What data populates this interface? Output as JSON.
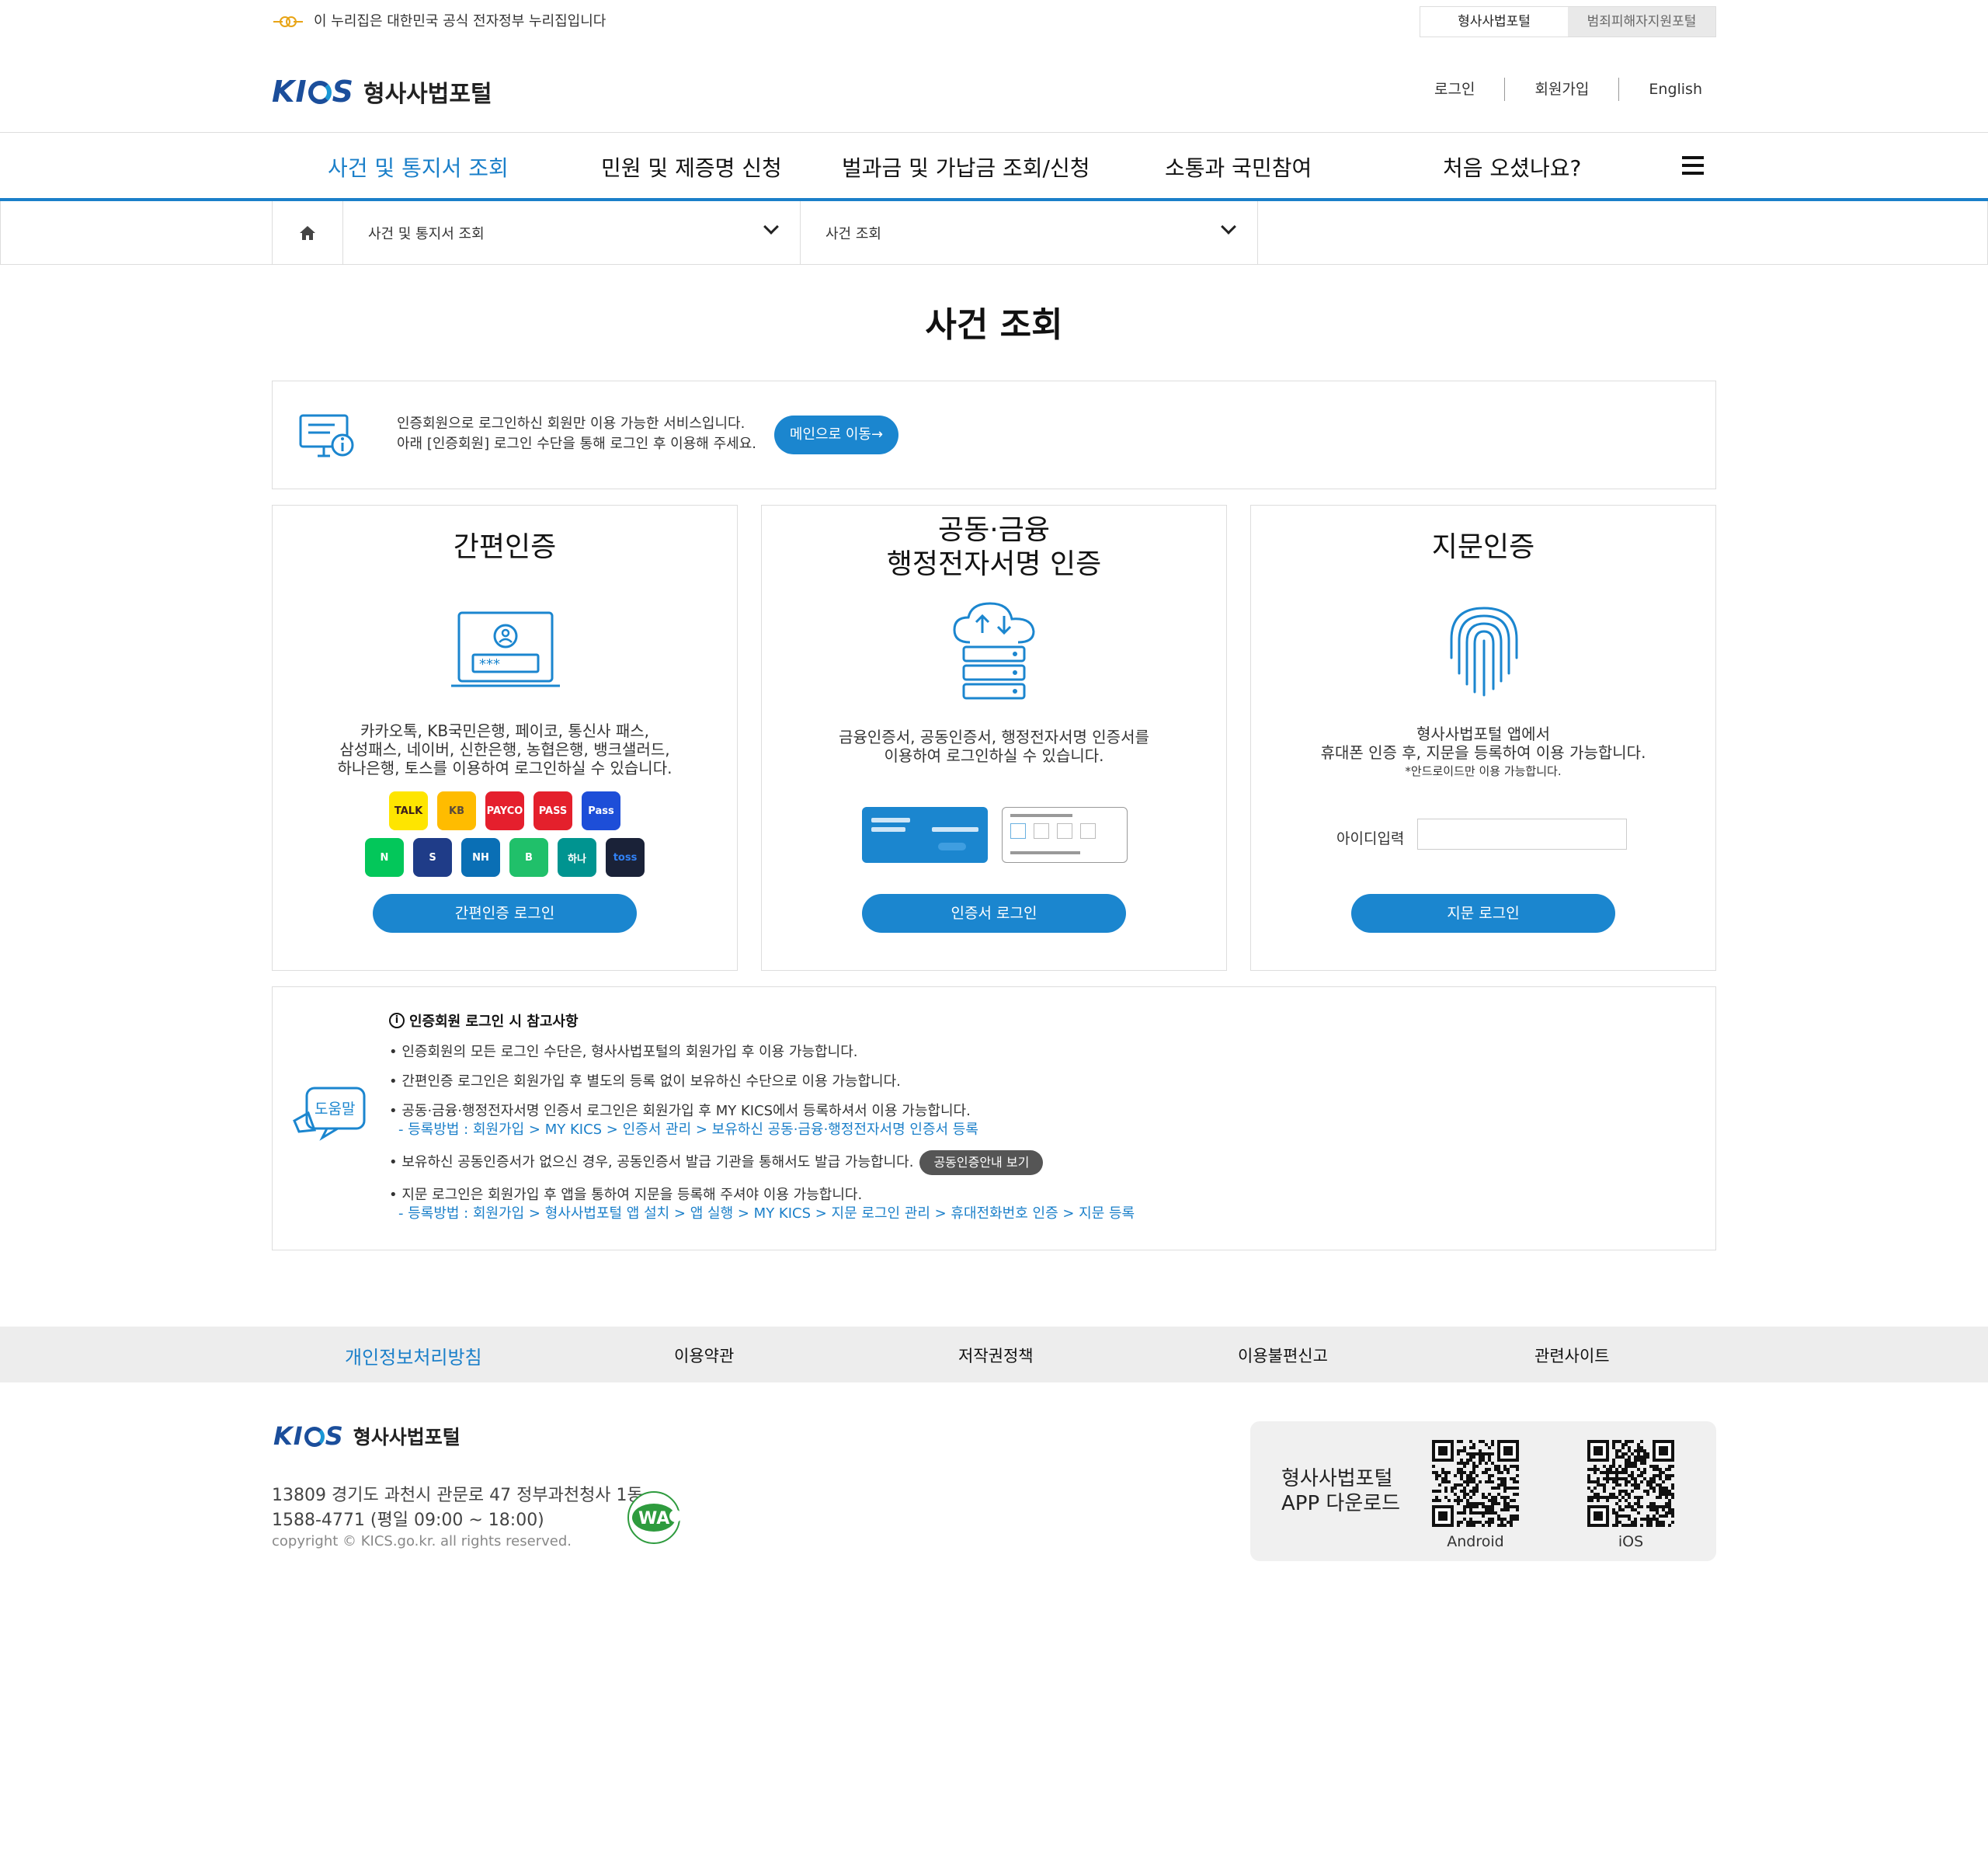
{
  "gov_banner": {
    "text": "이 누리집은 대한민국 공식 전자정부 누리집입니다",
    "tabs": [
      "형사사법포털",
      "범죄피해자지원포털"
    ]
  },
  "header": {
    "logo_mark": "KICS",
    "logo_text": "형사사법포털",
    "util": [
      "로그인",
      "회원가입",
      "English"
    ]
  },
  "gnb": [
    "사건 및 통지서 조회",
    "민원 및 제증명 신청",
    "벌과금 및 가납금 조회/신청",
    "소통과 국민참여",
    "처음 오셨나요?"
  ],
  "breadcrumb": {
    "level1": "사건 및 통지서 조회",
    "level2": "사건 조회"
  },
  "page_title": "사건 조회",
  "notice": {
    "line1": "인증회원으로 로그인하신 회원만 이용 가능한 서비스입니다.",
    "line2": "아래 [인증회원] 로그인 수단을 통해 로그인 후 이용해 주세요.",
    "button": "메인으로 이동→"
  },
  "cards": {
    "simple": {
      "title": "간편인증",
      "desc": [
        "카카오톡, KB국민은행, 페이코, 통신사 패스,",
        "삼성패스, 네이버, 신한은행, 농협은행, 뱅크샐러드,",
        "하나은행, 토스를 이용하여 로그인하실 수 있습니다."
      ],
      "apps_row1": [
        {
          "label": "TALK",
          "color": "#fee500",
          "fg": "#3a1d1d"
        },
        {
          "label": "KB",
          "color": "#ffbc00",
          "fg": "#5a4a3a"
        },
        {
          "label": "PAYCO",
          "color": "#e51f2d",
          "fg": "#ffffff"
        },
        {
          "label": "PASS",
          "color": "#e4202c",
          "fg": "#ffffff"
        },
        {
          "label": "Pass",
          "color": "#1d4ed8",
          "fg": "#ffffff"
        }
      ],
      "apps_row2": [
        {
          "label": "N",
          "color": "#03c75a",
          "fg": "#ffffff"
        },
        {
          "label": "S",
          "color": "#1f3c88",
          "fg": "#ffffff"
        },
        {
          "label": "NH",
          "color": "#0a6fb5",
          "fg": "#ffffff"
        },
        {
          "label": "B",
          "color": "#20c06a",
          "fg": "#ffffff"
        },
        {
          "label": "하나",
          "color": "#009490",
          "fg": "#ffffff"
        },
        {
          "label": "toss",
          "color": "#1a2238",
          "fg": "#3182f6"
        }
      ],
      "button": "간편인증 로그인"
    },
    "cert": {
      "title_line1": "공동·금융",
      "title_line2": "행정전자서명 인증",
      "desc": [
        "금융인증서, 공동인증서,  행정전자서명 인증서를",
        "이용하여 로그인하실 수 있습니다."
      ],
      "button": "인증서 로그인"
    },
    "finger": {
      "title": "지문인증",
      "desc": [
        "형사사법포털 앱에서",
        "휴대폰 인증 후, 지문을 등록하여 이용 가능합니다."
      ],
      "note": "*안드로이드만 이용 가능합니다.",
      "id_label": "아이디입력",
      "id_value": "",
      "button": "지문 로그인"
    }
  },
  "help": {
    "icon_label": "도움말",
    "heading": "인증회원 로그인 시 참고사항",
    "items": [
      {
        "text": "• 인증회원의 모든 로그인 수단은, 형사사법포털의 회원가입 후 이용 가능합니다."
      },
      {
        "text": "• 간편인증 로그인은 회원가입 후 별도의 등록 없이 보유하신 수단으로 이용 가능합니다."
      },
      {
        "text": "• 공동·금융·행정전자서명 인증서 로그인은 회원가입 후 MY KICS에서 등록하셔서 이용 가능합니다.",
        "sub": "- 등록방법 : 회원가입 > MY KICS > 인증서 관리 > 보유하신 공동·금융·행정전자서명 인증서 등록"
      },
      {
        "text": "• 보유하신 공동인증서가 없으신 경우, 공동인증서 발급 기관을 통해서도 발급 가능합니다.",
        "button": "공동인증안내 보기"
      },
      {
        "text": "• 지문 로그인은 회원가입 후 앱을 통하여 지문을 등록해 주셔야 이용 가능합니다.",
        "sub": "- 등록방법 : 회원가입 > 형사사법포털 앱 설치 > 앱 실행 > MY KICS > 지문 로그인 관리 > 휴대전화번호 인증 > 지문 등록"
      }
    ]
  },
  "footer": {
    "links": [
      "개인정보처리방침",
      "이용약관",
      "저작권정책",
      "이용불편신고",
      "관련사이트"
    ],
    "logo_text": "형사사법포털",
    "address": "13809  경기도 과천시 관문로 47 정부과천청사 1동",
    "phone": "1588-4771 (평일 09:00 ~ 18:00)",
    "copyright": "copyright © KICS.go.kr. all rights reserved.",
    "app_title_line1": "형사사법포털",
    "app_title_line2": "APP 다운로드",
    "qr_android": "Android",
    "qr_ios": "iOS"
  },
  "colors": {
    "accent": "#1a7fc9",
    "button": "#1b86cf"
  }
}
